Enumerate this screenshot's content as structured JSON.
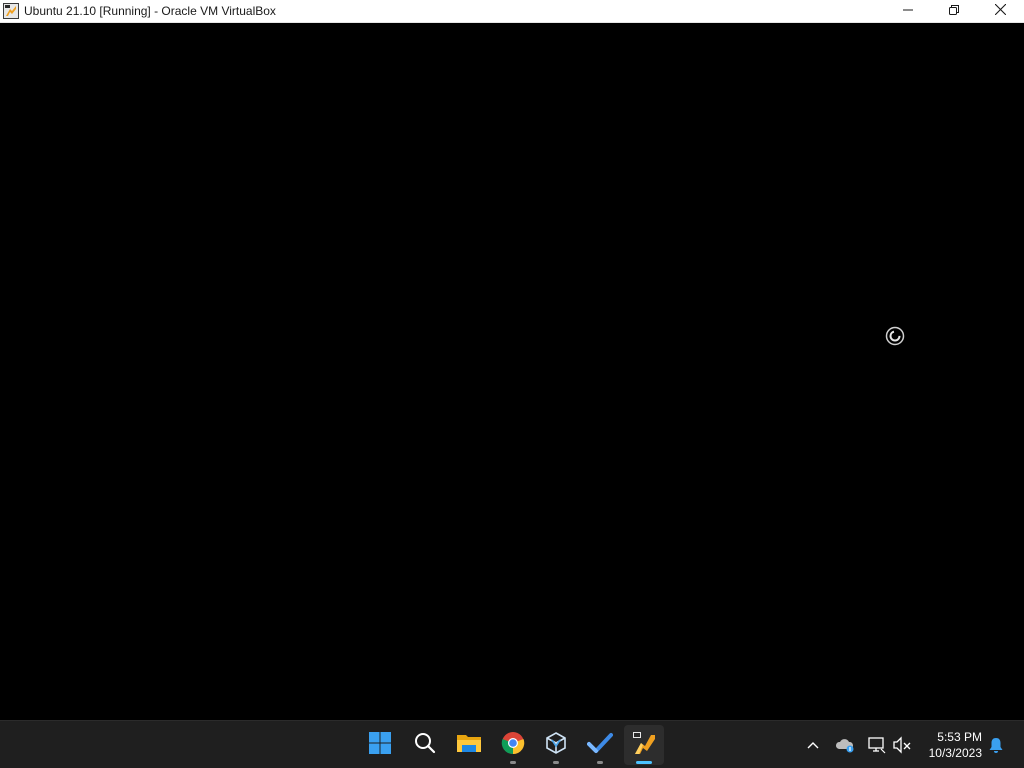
{
  "window": {
    "title": "Ubuntu 21.10 [Running] - Oracle VM VirtualBox",
    "controls": [
      "minimize-icon",
      "restore-icon",
      "close-icon"
    ]
  },
  "vm_screen": {
    "background": "#000000",
    "busy_indicator": "loading-spinner-icon"
  },
  "taskbar": {
    "pinned": [
      {
        "name": "start",
        "icon": "windows-start-icon",
        "running": false
      },
      {
        "name": "search",
        "icon": "search-icon",
        "running": false
      },
      {
        "name": "file-explorer",
        "icon": "folder-icon",
        "running": false
      },
      {
        "name": "chrome",
        "icon": "chrome-icon",
        "running": true
      },
      {
        "name": "virtualbox",
        "icon": "virtualbox-icon",
        "running": true
      },
      {
        "name": "todo",
        "icon": "checkmark-icon",
        "running": true
      },
      {
        "name": "vm-window",
        "icon": "ubuntu-vm-icon",
        "running": true,
        "active": true
      }
    ],
    "tray": {
      "icons": [
        "chevron-up-icon",
        "onedrive-cloud-icon",
        "network-icon",
        "volume-muted-icon",
        "notification-bell-icon"
      ],
      "time": "5:53 PM",
      "date": "10/3/2023"
    }
  },
  "colors": {
    "taskbar_bg": "#1f1f1f",
    "accent": "#4cc2ff",
    "titlebar_bg": "#ffffff"
  }
}
